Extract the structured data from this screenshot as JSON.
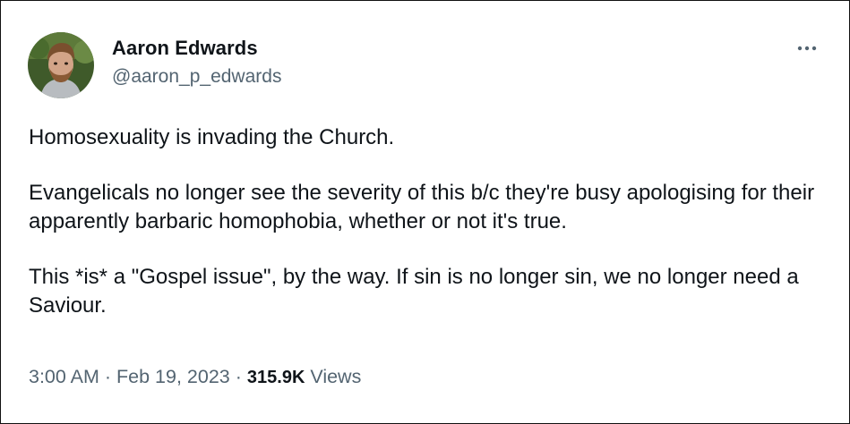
{
  "author": {
    "display_name": "Aaron Edwards",
    "handle": "@aaron_p_edwards",
    "avatar_icon": "profile-photo"
  },
  "menu": {
    "more_icon": "more-horizontal-icon"
  },
  "tweet": {
    "paragraphs": [
      "Homosexuality is invading the Church.",
      "Evangelicals no longer see the severity of this b/c they're busy apologising for their apparently barbaric homophobia, whether or not it's true.",
      "This *is* a \"Gospel issue\", by the way. If sin is no longer sin, we no longer need a Saviour."
    ]
  },
  "meta": {
    "time": "3:00 AM",
    "separator": "·",
    "date": "Feb 19, 2023",
    "views_count": "315.9K",
    "views_label": "Views"
  },
  "colors": {
    "text_primary": "#0f1419",
    "text_secondary": "#536471",
    "frame_border": "#111111"
  }
}
